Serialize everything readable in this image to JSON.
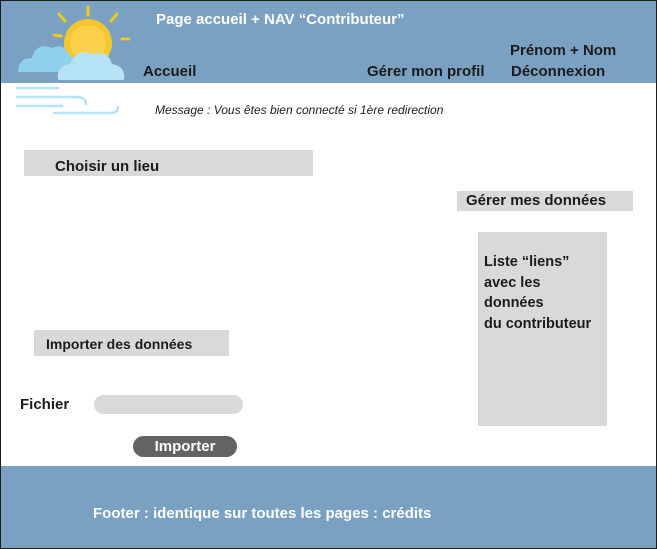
{
  "header": {
    "title": "Page accueil + NAV “Contributeur”",
    "logo_icon": "sun-cloud-wind-icon"
  },
  "nav": {
    "home_label": "Accueil",
    "profile_label": "Gérer mon profil",
    "user_name": "Prénom + Nom",
    "logout_label": "Déconnexion"
  },
  "message": "Message : Vous êtes bien connecté si 1ère redirection",
  "main": {
    "choose_place_label": "Choisir un lieu",
    "manage_data_label": "Gérer mes données",
    "links_list_text": "Liste “liens”\navec les\ndonnées\ndu contributeur",
    "import_section_label": "Importer des données",
    "file_label": "Fichier",
    "file_placeholder": "",
    "import_button_label": "Importer"
  },
  "footer": {
    "text": "Footer : identique sur toutes les pages : crédits"
  },
  "colors": {
    "header_bg": "#7aa0c2",
    "footer_bg": "#7aa0c2",
    "box_gray": "#d9d9d9",
    "button_dark": "#636363"
  }
}
